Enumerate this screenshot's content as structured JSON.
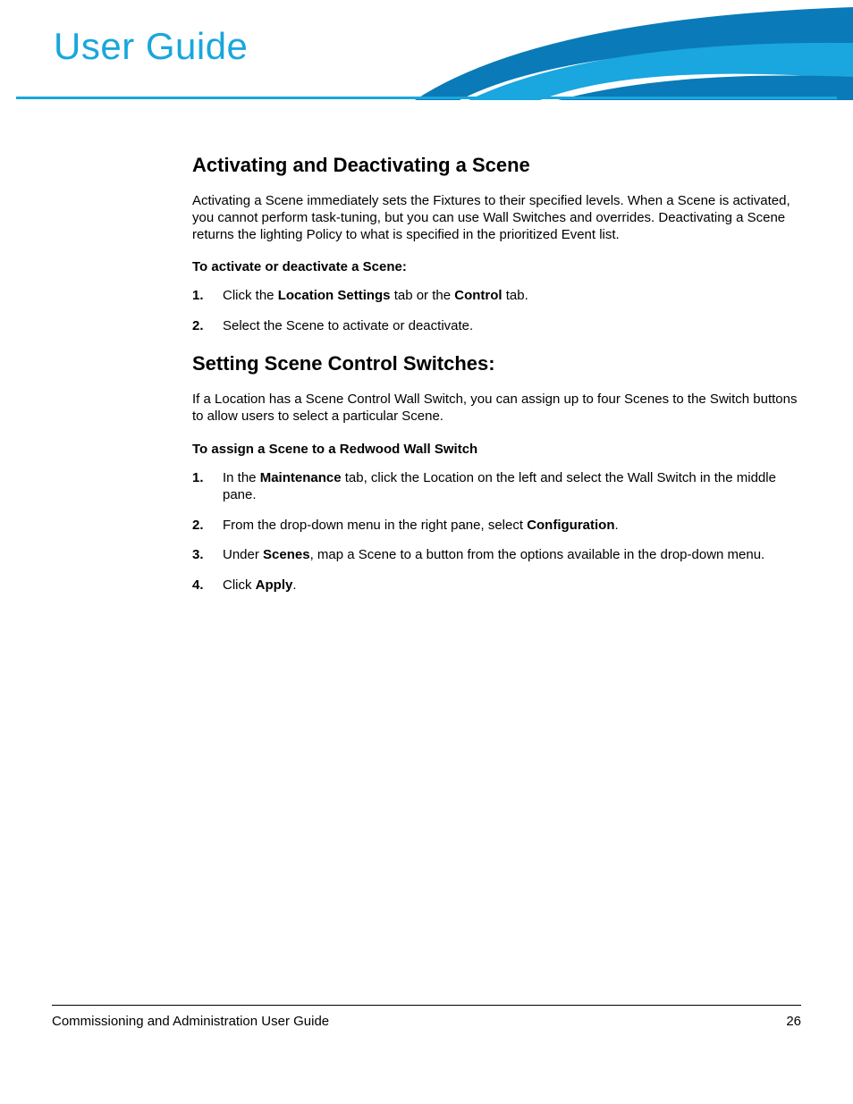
{
  "header": {
    "title": "User Guide"
  },
  "section1": {
    "heading": "Activating and Deactivating a Scene",
    "intro": "Activating a Scene immediately sets the Fixtures to their specified levels. When a Scene is activated, you cannot perform task-tuning, but you can use Wall Switches and overrides. Deactivating a Scene returns the lighting Policy to what is specified in the prioritized Event list.",
    "subhead": "To activate or deactivate a Scene:",
    "steps": [
      {
        "n": "1.",
        "pre": "Click the ",
        "b1": "Location Settings",
        "mid": " tab or the ",
        "b2": "Control",
        "post": " tab."
      },
      {
        "n": "2.",
        "text": "Select the Scene to activate or deactivate."
      }
    ]
  },
  "section2": {
    "heading": "Setting Scene Control Switches:",
    "intro": "If a Location has a Scene Control Wall Switch, you can assign up to four Scenes to the Switch buttons to allow users to select a particular Scene.",
    "subhead": "To assign a Scene to a Redwood Wall Switch",
    "steps": [
      {
        "n": "1.",
        "pre": "In the ",
        "b1": "Maintenance",
        "post": " tab, click the Location on the left and select the Wall Switch in the middle pane."
      },
      {
        "n": "2.",
        "pre": "From the drop-down menu in the right pane, select ",
        "b1": "Configuration",
        "post": "."
      },
      {
        "n": "3.",
        "pre": "Under ",
        "b1": "Scenes",
        "post": ", map a Scene to a button from the options available in the drop-down menu."
      },
      {
        "n": "4.",
        "pre": "Click ",
        "b1": "Apply",
        "post": "."
      }
    ]
  },
  "footer": {
    "title": "Commissioning and Administration User Guide",
    "page": "26"
  }
}
